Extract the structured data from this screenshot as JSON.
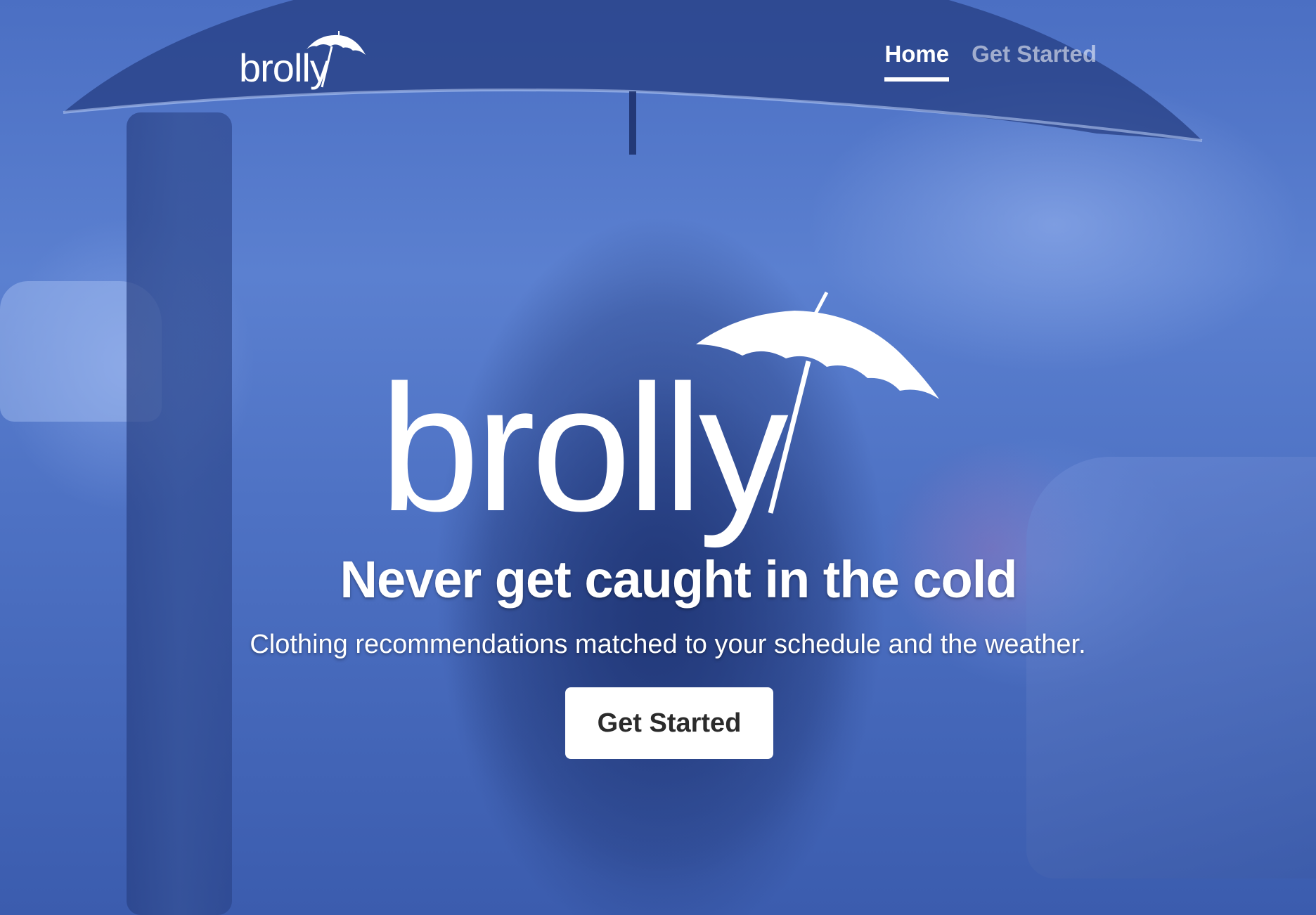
{
  "brand": {
    "name": "brolly",
    "color_primary": "#4a6dc2",
    "color_text": "#ffffff"
  },
  "nav": {
    "items": [
      {
        "label": "Home",
        "active": true
      },
      {
        "label": "Get Started",
        "active": false
      }
    ]
  },
  "hero": {
    "logo_text": "brolly",
    "headline": "Never get caught in the cold",
    "subheadline": "Clothing recommendations matched to your schedule and the weather.",
    "cta_label": "Get Started",
    "background_image": "person-with-umbrella-in-rainy-street"
  },
  "icons": {
    "logo_icon": "umbrella-icon"
  }
}
